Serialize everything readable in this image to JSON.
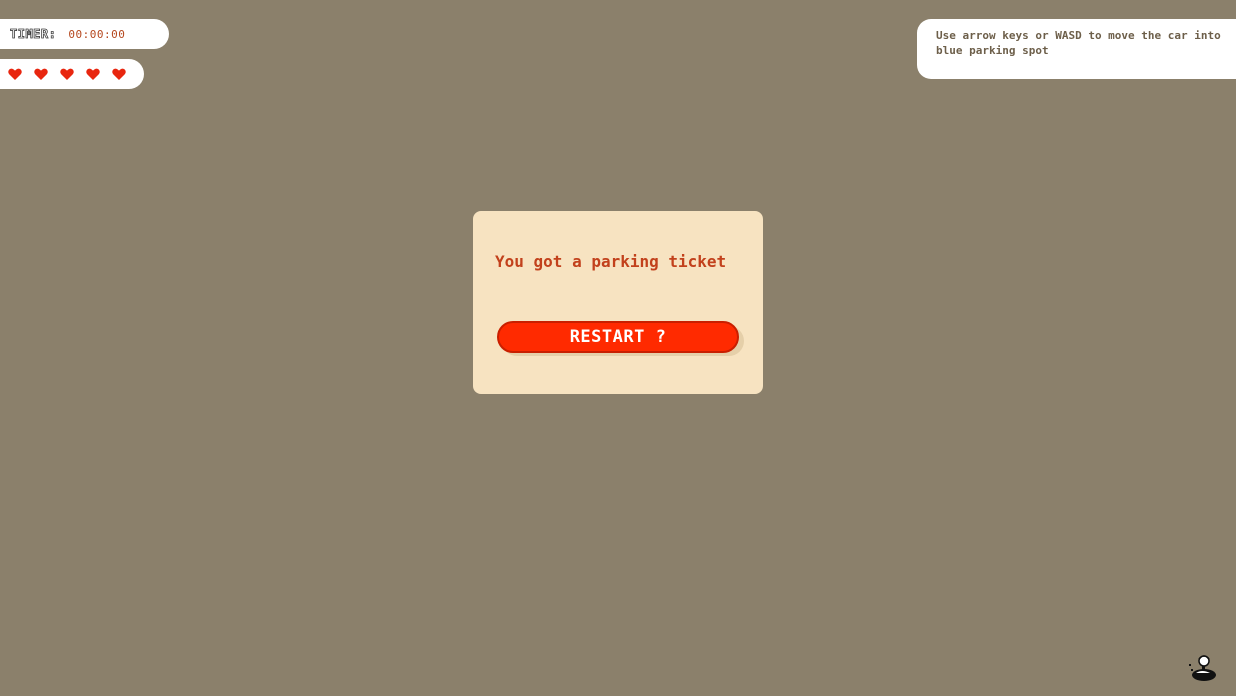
{
  "hud": {
    "timer_label": "TIMER:",
    "timer_value": "00:00:00",
    "lives": 5,
    "heart_color": "#e8260f"
  },
  "instructions": {
    "text": "Use arrow keys or WASD to move the car into blue parking spot"
  },
  "modal": {
    "message": "You got a parking ticket",
    "restart_label": "RESTART ?"
  },
  "colors": {
    "background": "#8b806b",
    "modal_bg": "#f7e3c1",
    "message_text": "#c2411c",
    "button": "#ff2a00",
    "timer_value": "#b5481f"
  },
  "icons": {
    "corner": "player-avatar-icon",
    "heart": "heart-icon"
  }
}
